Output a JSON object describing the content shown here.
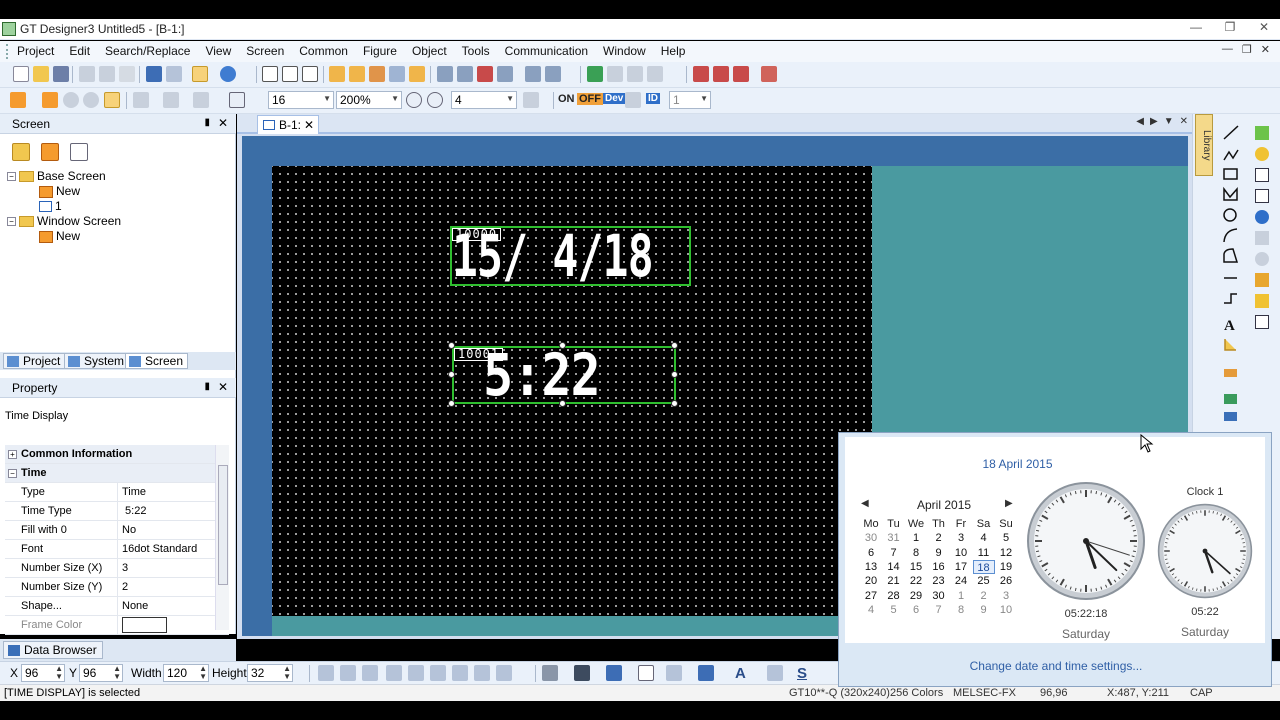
{
  "window": {
    "title": "GT Designer3 Untitled5 - [B-1:]"
  },
  "menu": {
    "items": [
      "Project",
      "Edit",
      "Search/Replace",
      "View",
      "Screen",
      "Common",
      "Figure",
      "Object",
      "Tools",
      "Communication",
      "Window",
      "Help"
    ]
  },
  "toolbar": {
    "font_size": "16",
    "zoom": "200%",
    "grid": "4",
    "on_label": "ON",
    "off_label": "OFF",
    "dev_label": "Dev",
    "id_label": "ID",
    "layer": "1"
  },
  "screen_panel": {
    "title": "Screen",
    "tree": {
      "base_screen": "Base Screen",
      "base_new": "New",
      "base_1": "1",
      "window_screen": "Window Screen",
      "window_new": "New"
    },
    "tabs": [
      "Project",
      "System",
      "Screen"
    ]
  },
  "property_panel": {
    "title": "Property",
    "object_name": "Time Display",
    "sections": {
      "common": "Common Information",
      "time": "Time"
    },
    "rows": [
      {
        "key": "Type",
        "value": "Time"
      },
      {
        "key": "Time Type",
        "value": " 5:22"
      },
      {
        "key": "Fill with 0",
        "value": "No"
      },
      {
        "key": "Font",
        "value": "16dot Standard"
      },
      {
        "key": "Number Size (X)",
        "value": "3"
      },
      {
        "key": "Number Size (Y)",
        "value": "2"
      },
      {
        "key": "Shape...",
        "value": "None"
      },
      {
        "key": "Frame Color",
        "value": ""
      }
    ]
  },
  "data_browser": {
    "label": "Data Browser"
  },
  "document": {
    "tab_label": "B-1:",
    "date_display": {
      "device": "10000",
      "value": "15/ 4/18"
    },
    "time_display": {
      "device": "10001",
      "value": " 5:22"
    }
  },
  "right_toolbar": {
    "library_label": "Library"
  },
  "bottom_toolbar": {
    "x_label": "X",
    "x_value": "96",
    "y_label": "Y",
    "y_value": "96",
    "width_label": "Width",
    "width_value": "120",
    "height_label": "Height",
    "height_value": "32"
  },
  "status": {
    "message": "[TIME DISPLAY] is selected",
    "model": "GT10**-Q (320x240)",
    "colors": "256 Colors",
    "plc": "MELSEC-FX",
    "coords1": "96,96",
    "coords2": "X:487, Y:211",
    "caps": "CAP"
  },
  "calendar_flyout": {
    "long_date": "18 April 2015",
    "month_label": "April 2015",
    "weekdays": [
      "Mo",
      "Tu",
      "We",
      "Th",
      "Fr",
      "Sa",
      "Su"
    ],
    "weeks": [
      [
        "30",
        "31",
        "1",
        "2",
        "3",
        "4",
        "5"
      ],
      [
        "6",
        "7",
        "8",
        "9",
        "10",
        "11",
        "12"
      ],
      [
        "13",
        "14",
        "15",
        "16",
        "17",
        "18",
        "19"
      ],
      [
        "20",
        "21",
        "22",
        "23",
        "24",
        "25",
        "26"
      ],
      [
        "27",
        "28",
        "29",
        "30",
        "1",
        "2",
        "3"
      ],
      [
        "4",
        "5",
        "6",
        "7",
        "8",
        "9",
        "10"
      ]
    ],
    "selected_day": "18",
    "clock_main_time": "05:22:18",
    "clock_main_day": "Saturday",
    "clock1_title": "Clock 1",
    "clock1_time": "05:22",
    "clock1_day": "Saturday",
    "settings_link": "Change date and time settings..."
  }
}
